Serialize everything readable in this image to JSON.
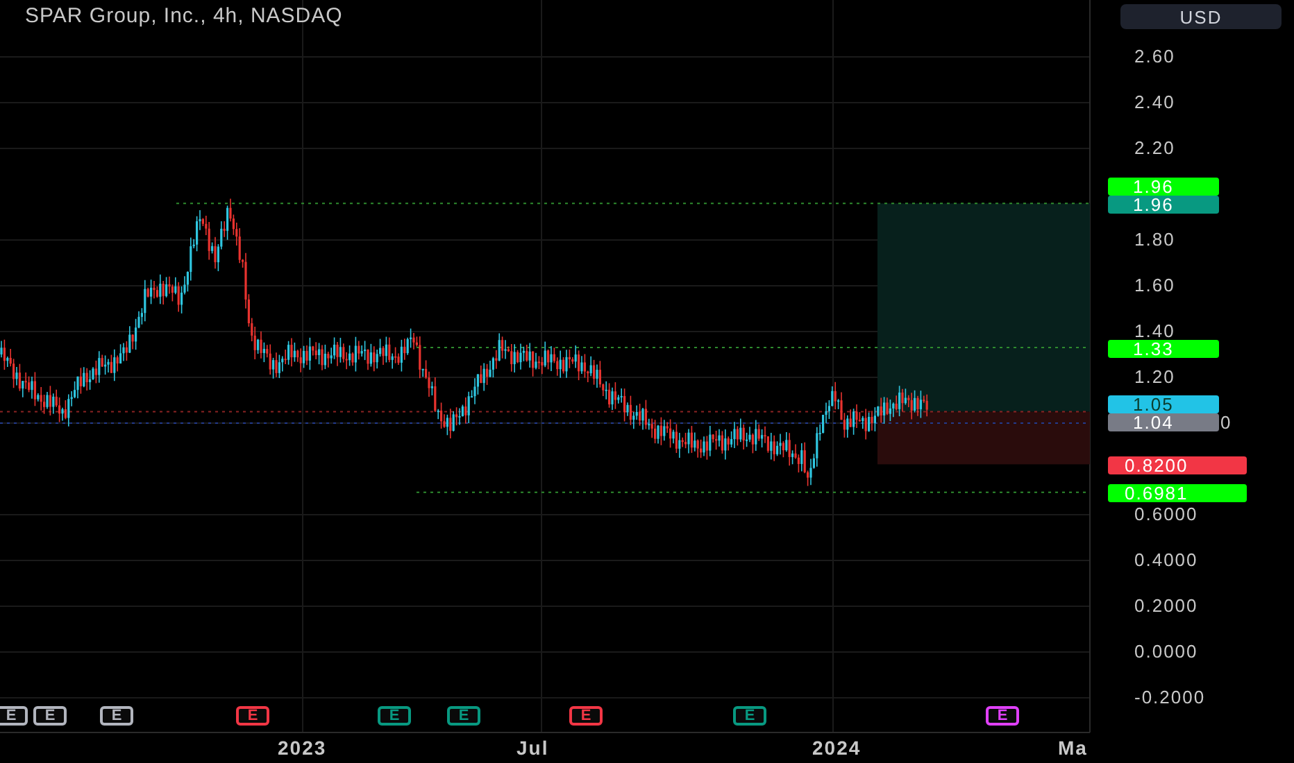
{
  "chart": {
    "title": "SPAR Group, Inc., 4h, NASDAQ"
  },
  "currency_button": {
    "label": "USD"
  },
  "price_axis": {
    "ticks": [
      "2.60",
      "2.40",
      "2.20",
      "1.80",
      "1.60",
      "1.40",
      "1.20",
      "0",
      "0.6000",
      "0.4000",
      "0.2000",
      "0.0000",
      "-0.2000"
    ]
  },
  "price_labels": [
    {
      "text": "1.96",
      "color": "#00ff00"
    },
    {
      "text": "1.96",
      "color": "#089981"
    },
    {
      "text": "1.33",
      "color": "#00ff00"
    },
    {
      "text": "1.05",
      "color": "#22c3e6"
    },
    {
      "text": "1.04",
      "color": "#787b86"
    },
    {
      "text": "0.8200",
      "color": "#f23645"
    },
    {
      "text": "0.6981",
      "color": "#00ff00"
    }
  ],
  "earnings_markers": [
    {
      "label": "E",
      "color": "#b2b5be"
    },
    {
      "label": "E",
      "color": "#b2b5be"
    },
    {
      "label": "E",
      "color": "#b2b5be"
    },
    {
      "label": "E",
      "color": "#f23645"
    },
    {
      "label": "E",
      "color": "#089981"
    },
    {
      "label": "E",
      "color": "#089981"
    },
    {
      "label": "E",
      "color": "#f23645"
    },
    {
      "label": "E",
      "color": "#089981"
    },
    {
      "label": "E",
      "color": "#e040fb"
    }
  ],
  "time_axis": {
    "labels": [
      "2023",
      "Jul",
      "2024",
      "Ma"
    ]
  }
}
